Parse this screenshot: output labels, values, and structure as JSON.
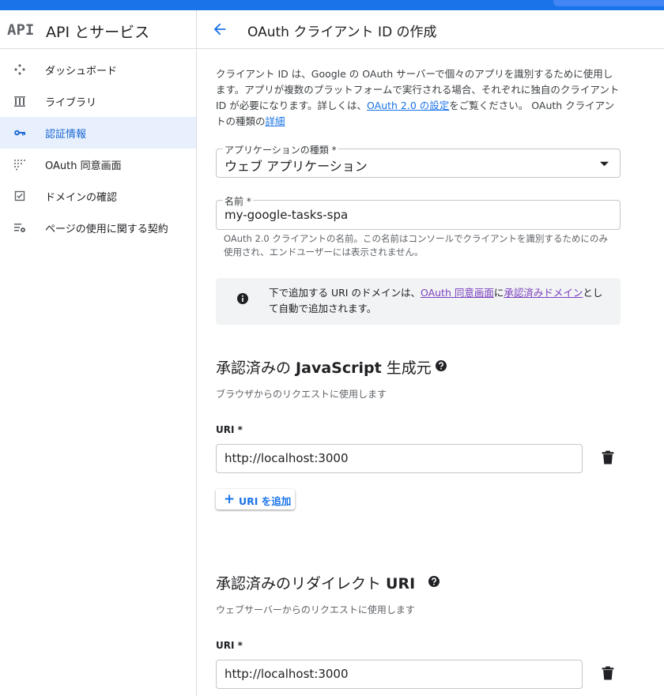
{
  "sidebar": {
    "logo": "API",
    "title": "API とサービス",
    "items": [
      {
        "label": "ダッシュボード",
        "icon": "dashboard-icon"
      },
      {
        "label": "ライブラリ",
        "icon": "library-icon"
      },
      {
        "label": "認証情報",
        "icon": "key-icon",
        "active": true
      },
      {
        "label": "OAuth 同意画面",
        "icon": "consent-screen-icon"
      },
      {
        "label": "ドメインの確認",
        "icon": "checkbox-icon"
      },
      {
        "label": "ページの使用に関する契約",
        "icon": "settings-list-icon"
      }
    ]
  },
  "header": {
    "title": "OAuth クライアント ID の作成"
  },
  "intro": {
    "part1": "クライアント ID は、Google の OAuth サーバーで個々のアプリを識別するために使用します。アプリが複数のプラットフォームで実行される場合、それぞれに独自のクライアント ID が必要になります。詳しくは、",
    "link1": "OAuth 2.0 の設定",
    "part2": "をご覧ください。 OAuth クライアントの種類の",
    "link2": "詳細"
  },
  "app_type": {
    "label": "アプリケーションの種類 *",
    "value": "ウェブ アプリケーション"
  },
  "name_field": {
    "label": "名前 *",
    "value": "my-google-tasks-spa",
    "hint": "OAuth 2.0 クライアントの名前。この名前はコンソールでクライアントを識別するためにのみ使用され、エンドユーザーには表示されません。"
  },
  "info": {
    "part1": "下で追加する URI のドメインは、",
    "link1": "OAuth 同意画面",
    "part2": "に",
    "link2": "承認済みドメイン",
    "part3": "として自動で追加されます。"
  },
  "js_origins": {
    "title_a": "承認済みの ",
    "title_b": "JavaScript",
    "title_c": " 生成元",
    "subtitle": "ブラウザからのリクエストに使用します",
    "uri_label": "URI *",
    "uri_value": "http://localhost:3000",
    "add_button": "URI を追加"
  },
  "redirect": {
    "title_a": "承認済みのリダイレクト ",
    "title_b": "URI",
    "subtitle": "ウェブサーバーからのリクエストに使用します",
    "uri_label": "URI *",
    "uri_value": "http://localhost:3000"
  },
  "colors": {
    "accent": "#1a73e8",
    "active_bg": "#e8f0fe",
    "info_bg": "#f1f3f4"
  }
}
